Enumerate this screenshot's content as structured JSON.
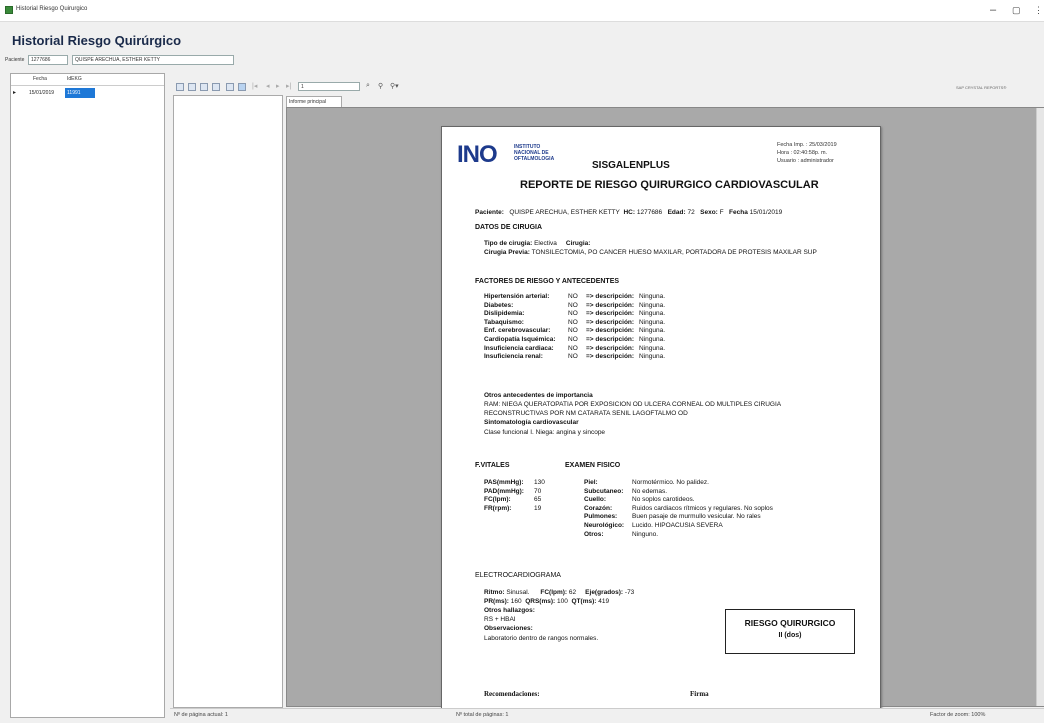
{
  "window": {
    "title": "Historial Riesgo Quirurgico",
    "minimize": "–",
    "maximize": "▢",
    "close": "⋮"
  },
  "app": {
    "title": "Historial Riesgo Quirúrgico"
  },
  "patient": {
    "label": "Paciente",
    "id": "1277686",
    "name": "QUISPE ARECHUA, ESTHER KETTY"
  },
  "grid": {
    "col_date": "Fecha",
    "col_id": "IdEKG",
    "rows": [
      {
        "date": "15/01/2019",
        "id": "11991"
      }
    ]
  },
  "viewer": {
    "page_input": "1",
    "tab": "Informe principal",
    "right_label": "SAP CRYSTAL REPORTS®"
  },
  "status": {
    "current_page": "Nº de página actual: 1",
    "total_pages": "Nº total de páginas: 1",
    "zoom": "Factor de zoom: 100%"
  },
  "report": {
    "logo_text": "INO",
    "inst_line1": "INSTITUTO",
    "inst_line2": "NACIONAL DE",
    "inst_line3": "OFTALMOLOGIA",
    "print_date": "Fecha Imp. : 25/03/2019",
    "print_time": "Hora : 02:40:58p. m.",
    "print_user": "Usuario : administrador",
    "system": "SISGALENPLUS",
    "title": "REPORTE DE RIESGO QUIRURGICO CARDIOVASCULAR",
    "pac_label": "Paciente:",
    "pac_name": "QUISPE ARECHUA, ESTHER KETTY",
    "hc_label": "HC:",
    "hc": "1277686",
    "edad_label": "Edad:",
    "edad": "72",
    "sexo_label": "Sexo:",
    "sexo": "F",
    "fecha_label": "Fecha",
    "fecha": "15/01/2019",
    "datos_cirugia": "DATOS DE CIRUGIA",
    "tipo_label": "Tipo de cirugia:",
    "tipo": "Electiva",
    "cirugia_label": "Cirugia:",
    "previa_label": "Cirugia Previa:",
    "previa": "TONSILECTOMIA, PO CANCER HUESO MAXILAR, PORTADORA DE PROTESIS MAXILAR SUP",
    "factores_title": "FACTORES DE RIESGO Y ANTECEDENTES",
    "desc_label": "=> descripción:",
    "factores": [
      {
        "name": "Hipertensión arterial:",
        "val": "NO",
        "desc": "Ninguna."
      },
      {
        "name": "Diabetes:",
        "val": "NO",
        "desc": "Ninguna."
      },
      {
        "name": "Dislipidemia:",
        "val": "NO",
        "desc": "Ninguna."
      },
      {
        "name": "Tabaquismo:",
        "val": "NO",
        "desc": "Ninguna."
      },
      {
        "name": "Enf. cerebrovascular:",
        "val": "NO",
        "desc": "Ninguna."
      },
      {
        "name": "Cardiopatía Isquémica:",
        "val": "NO",
        "desc": "Ninguna."
      },
      {
        "name": "Insuficiencia cardiaca:",
        "val": "NO",
        "desc": "Ninguna."
      },
      {
        "name": "Insuficiencia renal:",
        "val": "NO",
        "desc": "Ninguna."
      }
    ],
    "otros_title": "Otros antecedentes de importancia",
    "otros_line1": "RAM: NIEGA  QUERATOPATIA POR EXPOSICION OD  ULCERA CORNEAL OD  MULTIPLES CIRUGIA",
    "otros_line2": "RECONSTRUCTIVAS POR NM  CATARATA SENIL  LAGOFTALMO OD",
    "sinto_title": "Sintomatología cardiovascular",
    "sinto": "Clase funcional I. Niega: angina y sincope",
    "fvitales": "F.VITALES",
    "examen": "EXAMEN FISICO",
    "vitales": [
      {
        "name": "PAS(mmHg):",
        "val": "130"
      },
      {
        "name": "PAD(mmHg):",
        "val": "70"
      },
      {
        "name": "FC(lpm):",
        "val": "65"
      },
      {
        "name": "FR(rpm):",
        "val": "19"
      }
    ],
    "fisico": [
      {
        "name": "Piel:",
        "val": "Normotérmico. No palidez."
      },
      {
        "name": "Subcutaneo:",
        "val": "No edemas."
      },
      {
        "name": "Cuello:",
        "val": "No soplos carotideos."
      },
      {
        "name": "Corazón:",
        "val": "Ruidos cardiacos rítmicos y regulares. No soplos"
      },
      {
        "name": "Pulmones:",
        "val": "Buen pasaje de murmullo vesicular. No rales"
      },
      {
        "name": "Neurológico:",
        "val": "Lucido.  HIPOACUSIA SEVERA"
      },
      {
        "name": "Otros:",
        "val": "Ninguno."
      }
    ],
    "ecg_title": "ELECTROCARDIOGRAMA",
    "ritmo_label": "Ritmo:",
    "ritmo": "Sinusal.",
    "fc_label": "FC(lpm):",
    "fc": "62",
    "eje_label": "Eje(grados):",
    "eje": "-73",
    "pr_label": "PR(ms):",
    "pr": "160",
    "qrs_label": "QRS(ms):",
    "qrs": "100",
    "qt_label": "QT(ms):",
    "qt": "419",
    "hallazgos_label": "Otros hallazgos:",
    "hallazgos": "RS + HBAI",
    "obs_label": "Observaciones:",
    "obs": "Laboratorio dentro de rangos normales.",
    "riesgo_title": "RIESGO QUIRURGICO",
    "riesgo_val": "II (dos)",
    "recom_label": "Recomendaciones:",
    "firma_label": "Firma"
  }
}
